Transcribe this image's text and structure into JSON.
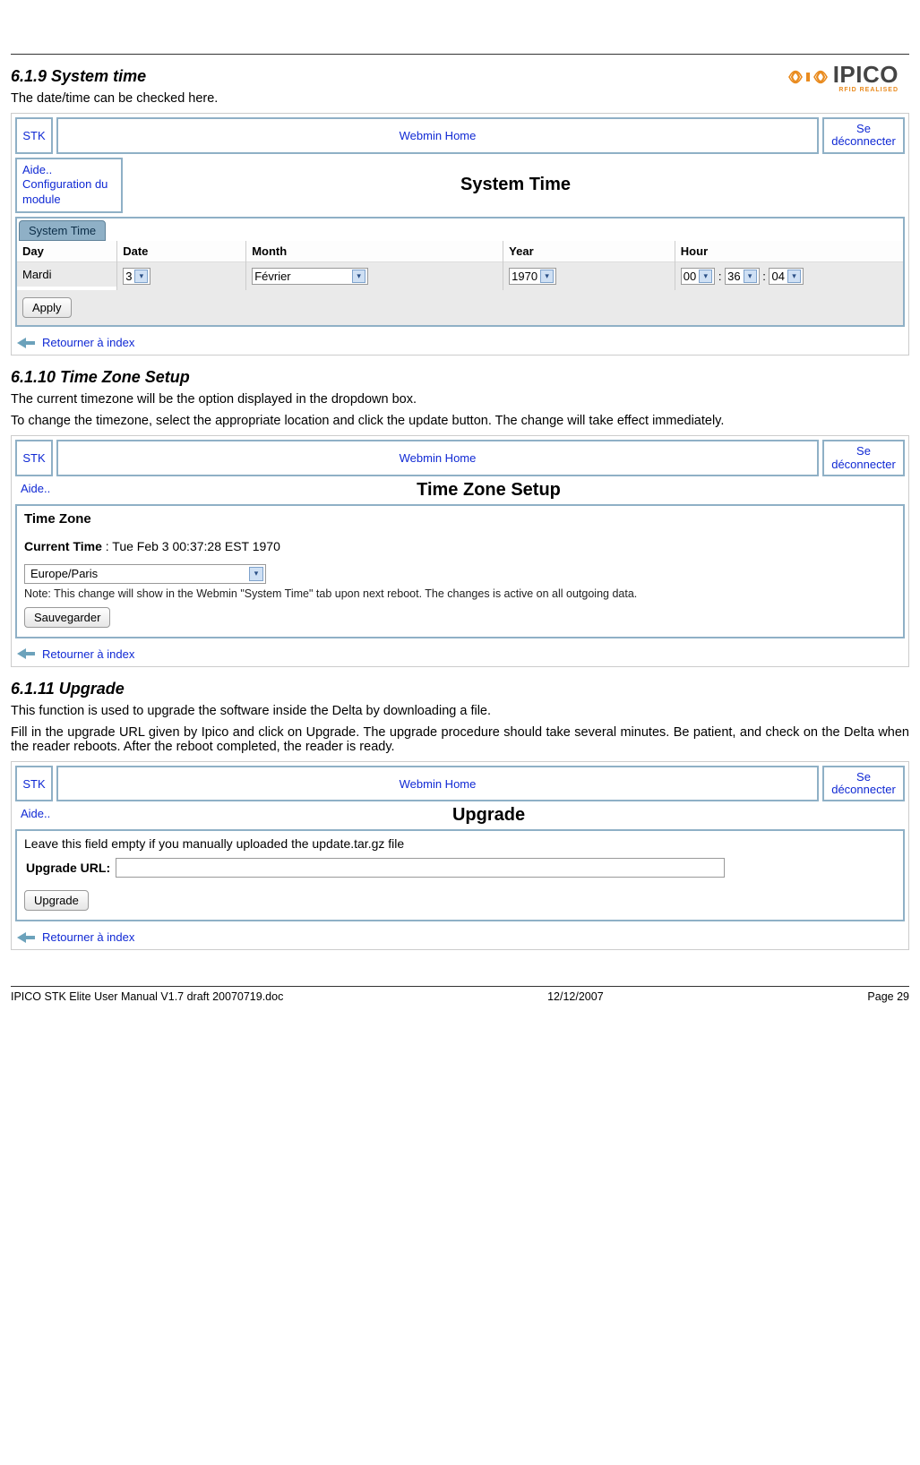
{
  "header": {
    "logo_text": "IPICO",
    "logo_tagline": "RFID REALISED"
  },
  "s1": {
    "heading": "6.1.9   System time",
    "para1": "The date/time can be checked here."
  },
  "s2": {
    "heading": "6.1.10 Time Zone Setup",
    "para1": "The current timezone will be the option displayed in the dropdown box.",
    "para2": "To change the timezone, select the appropriate location and click the update button. The change will take effect immediately."
  },
  "s3": {
    "heading": "6.1.11 Upgrade",
    "para1": "This function is used to upgrade the software inside the Delta by downloading a file.",
    "para2": "Fill in the upgrade URL given by Ipico and click on Upgrade. The upgrade procedure should take several minutes. Be patient, and check on the Delta when the reader reboots. After the reboot completed, the reader is ready."
  },
  "webmin": {
    "stk": "STK",
    "home": "Webmin Home",
    "logout1": "Se",
    "logout2": "déconnecter",
    "aide": "Aide..",
    "aide_config1": "Configuration du",
    "aide_config2": "module",
    "return_label": "Retourner à index"
  },
  "shot1": {
    "title": "System Time",
    "tab": "System Time",
    "cols": {
      "day_h": "Day",
      "date_h": "Date",
      "month_h": "Month",
      "year_h": "Year",
      "hour_h": "Hour",
      "day_v": "Mardi",
      "date_v": "3",
      "month_v": "Février",
      "year_v": "1970",
      "hh": "00",
      "mm": "36",
      "ss": "04",
      "sep": ":"
    },
    "apply": "Apply"
  },
  "shot2": {
    "title": "Time Zone Setup",
    "tz_label": "Time Zone",
    "ct_label": "Current Time",
    "ct_value": "Tue Feb 3 00:37:28 EST 1970",
    "tz_sel": "Europe/Paris",
    "note": "Note: This change will show in the Webmin \"System Time\" tab upon next reboot. The changes is active on all outgoing data.",
    "save": "Sauvegarder"
  },
  "shot3": {
    "title": "Upgrade",
    "hint": "Leave this field empty if you manually uploaded the update.tar.gz file",
    "url_label": "Upgrade URL:",
    "btn": "Upgrade"
  },
  "footer": {
    "left": "IPICO STK Elite User Manual V1.7 draft 20070719.doc",
    "mid": "12/12/2007",
    "right": "Page 29"
  }
}
